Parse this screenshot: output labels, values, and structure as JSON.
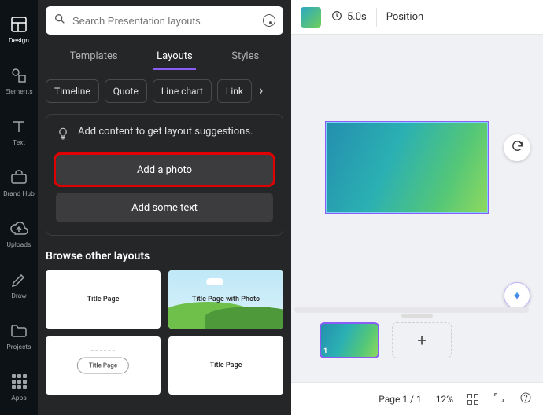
{
  "sidebar": {
    "items": [
      {
        "label": "Design"
      },
      {
        "label": "Elements"
      },
      {
        "label": "Text"
      },
      {
        "label": "Brand Hub"
      },
      {
        "label": "Uploads"
      },
      {
        "label": "Draw"
      },
      {
        "label": "Projects"
      },
      {
        "label": "Apps"
      }
    ]
  },
  "search": {
    "placeholder": "Search Presentation layouts"
  },
  "tabs": [
    {
      "label": "Templates"
    },
    {
      "label": "Layouts"
    },
    {
      "label": "Styles"
    }
  ],
  "chips": [
    {
      "label": "Timeline"
    },
    {
      "label": "Quote"
    },
    {
      "label": "Line chart"
    },
    {
      "label": "Link"
    }
  ],
  "suggest": {
    "message": "Add content to get layout suggestions.",
    "add_photo": "Add a photo",
    "add_text": "Add some text"
  },
  "browse": {
    "heading": "Browse other layouts",
    "items": [
      {
        "label": "Title Page"
      },
      {
        "label": "Title Page with Photo"
      },
      {
        "label": "Title Page"
      },
      {
        "label": "Title Page"
      }
    ]
  },
  "topbar": {
    "duration": "5.0s",
    "position": "Position"
  },
  "pages": {
    "thumb_number": "1",
    "indicator": "Page 1 / 1",
    "zoom": "12%"
  }
}
